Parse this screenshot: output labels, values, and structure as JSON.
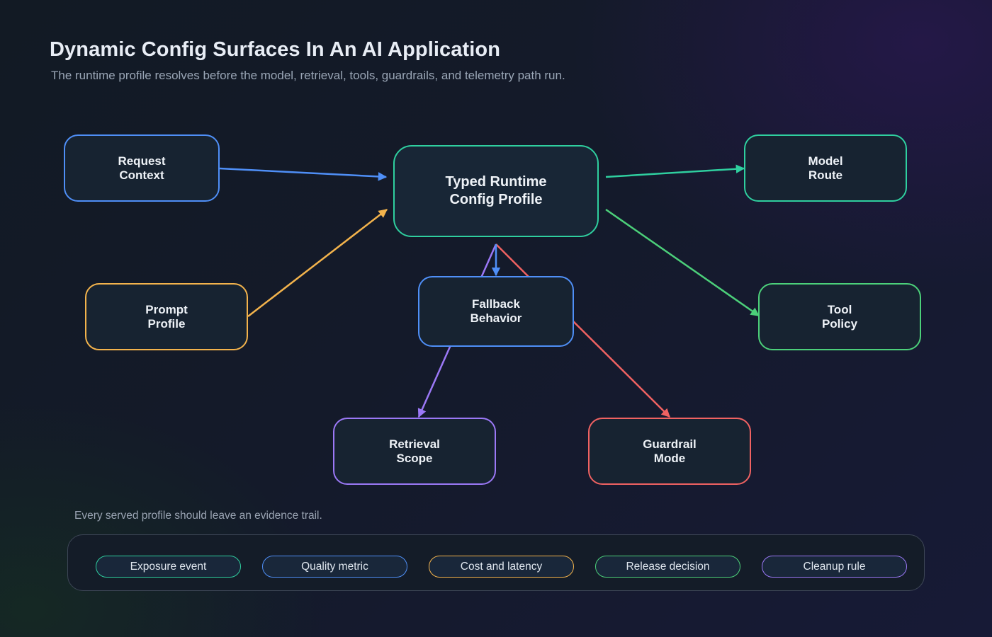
{
  "header": {
    "title": "Dynamic Config Surfaces In An AI Application",
    "subtitle": "The runtime profile resolves before the model, retrieval, tools, guardrails, and telemetry path run."
  },
  "nodes": {
    "request_context": {
      "label": "Request\nContext"
    },
    "prompt_profile": {
      "label": "Prompt\nProfile"
    },
    "runtime_profile": {
      "label": "Typed Runtime\nConfig Profile"
    },
    "model_route": {
      "label": "Model\nRoute"
    },
    "tool_policy": {
      "label": "Tool\nPolicy"
    },
    "fallback_behavior": {
      "label": "Fallback\nBehavior"
    },
    "retrieval_scope": {
      "label": "Retrieval\nScope"
    },
    "guardrail_mode": {
      "label": "Guardrail\nMode"
    }
  },
  "edges": [
    {
      "from": "request_context",
      "to": "runtime_profile",
      "color": "#4f8ff7"
    },
    {
      "from": "prompt_profile",
      "to": "runtime_profile",
      "color": "#f3b34c"
    },
    {
      "from": "runtime_profile",
      "to": "model_route",
      "color": "#2fcf9f"
    },
    {
      "from": "runtime_profile",
      "to": "tool_policy",
      "color": "#4cd07a"
    },
    {
      "from": "runtime_profile",
      "to": "fallback_behavior",
      "color": "#4f8ff7"
    },
    {
      "from": "runtime_profile",
      "to": "retrieval_scope",
      "color": "#9b78f6"
    },
    {
      "from": "runtime_profile",
      "to": "guardrail_mode",
      "color": "#f06262"
    }
  ],
  "evidence": {
    "caption": "Every served profile should leave an evidence trail.",
    "items": [
      {
        "label": "Exposure event",
        "color": "#2fcf9f"
      },
      {
        "label": "Quality metric",
        "color": "#4f8ff7"
      },
      {
        "label": "Cost and latency",
        "color": "#f3b34c"
      },
      {
        "label": "Release decision",
        "color": "#4cd07a"
      },
      {
        "label": "Cleanup rule",
        "color": "#9b78f6"
      }
    ]
  },
  "colors": {
    "blue": "#4f8ff7",
    "teal": "#2fcf9f",
    "orange": "#f3b34c",
    "green": "#4cd07a",
    "purple": "#9b78f6",
    "red": "#f06262"
  }
}
